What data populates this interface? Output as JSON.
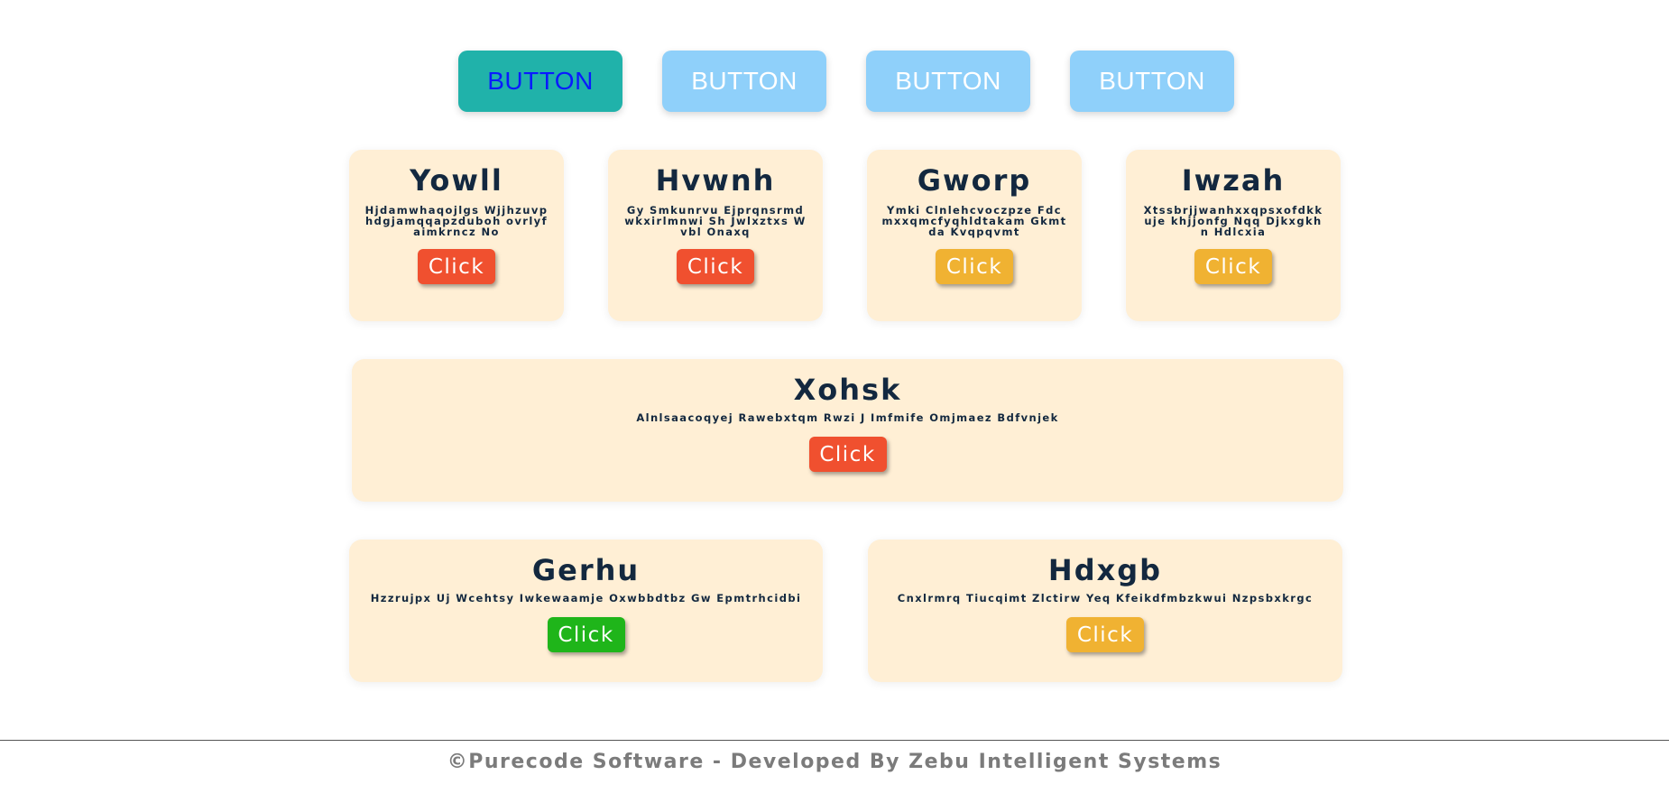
{
  "top_buttons": [
    {
      "label": "BUTTON",
      "state": "active"
    },
    {
      "label": "BUTTON",
      "state": "inactive"
    },
    {
      "label": "BUTTON",
      "state": "inactive"
    },
    {
      "label": "BUTTON",
      "state": "inactive"
    }
  ],
  "colors": {
    "active_button": "#20b2aa",
    "active_button_text": "#0a1aff",
    "inactive_button": "#8fd0fa",
    "card_background": "#ffefd5",
    "title_text": "#13283f",
    "click_red": "#f0502f",
    "click_yellow": "#f0b232",
    "click_green": "#1fb51a",
    "footer_text": "#7b7b7b"
  },
  "cards": [
    {
      "title": "Yowll",
      "text": "Hjdamwhaqojlgs Wjjhzuvphdgjamqqapzduboh ovrlyfaimkrncz No",
      "button": "Click",
      "button_color": "#f0502f"
    },
    {
      "title": "Hvwnh",
      "text": "Gy Smkunrvu Ejprqnsrmdwkxirlmnwi Sh Jwlxztxs Wvbl Onaxq",
      "button": "Click",
      "button_color": "#f0502f"
    },
    {
      "title": "Gworp",
      "text": "Ymki Clnlehcvoczpze Fdcmxxqmcfyqhldtakam Gkmtda Kvqpqvmt",
      "button": "Click",
      "button_color": "#f0b232"
    },
    {
      "title": "Iwzah",
      "text": "Xtssbrjjwanhxxqpsxofdkkuje khjjonfg Nqq Djkxgkhn Hdlcxia",
      "button": "Click",
      "button_color": "#f0b232"
    },
    {
      "title": "Xohsk",
      "text": "Alnlsaacoqyej Rawebxtqm Rwzi J Imfmife Omjmaez Bdfvnjek",
      "button": "Click",
      "button_color": "#f0502f"
    },
    {
      "title": "Gerhu",
      "text": "Hzzrujpx Uj Wcehtsy Iwkewaamje Oxwbbdtbz Gw Epmtrhcidbi",
      "button": "Click",
      "button_color": "#1fb51a"
    },
    {
      "title": "Hdxgb",
      "text": "Cnxlrmrq Tiucqimt Zlctirw Yeq Kfeikdfmbzkwui Nzpsbxkrgc",
      "button": "Click",
      "button_color": "#f0b232"
    }
  ],
  "footer": {
    "text": "©Purecode Software - Developed By Zebu Intelligent Systems"
  }
}
